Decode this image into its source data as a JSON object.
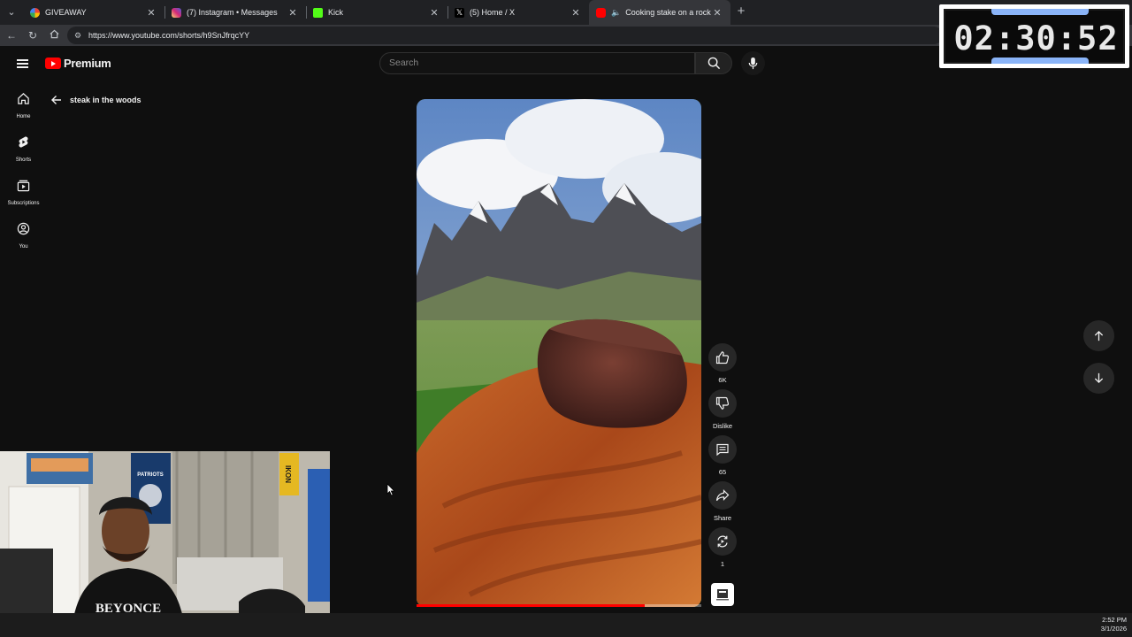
{
  "browser": {
    "tabs": [
      {
        "title": "GIVEAWAY",
        "favicon_color": "#4285f4"
      },
      {
        "title": "(7) Instagram • Messages",
        "favicon_color": "#d6249f"
      },
      {
        "title": "Kick",
        "favicon_color": "#53fc18"
      },
      {
        "title": "(5) Home / X",
        "favicon_color": "#ffffff"
      },
      {
        "title": "Cooking stake on a rock in m",
        "favicon_color": "#ff0000",
        "active": true
      }
    ],
    "url": "https://www.youtube.com/shorts/h9SnJfrqcYY"
  },
  "youtube": {
    "logo_text": "Premium",
    "search_placeholder": "Search",
    "accent": "#ff0000",
    "guide": [
      {
        "label": "Home",
        "icon": "home-icon"
      },
      {
        "label": "Shorts",
        "icon": "shorts-icon"
      },
      {
        "label": "Subscriptions",
        "icon": "subscriptions-icon"
      },
      {
        "label": "You",
        "icon": "you-icon"
      }
    ],
    "back_title": "steak in the woods"
  },
  "short": {
    "like_count": "6K",
    "dislike_label": "Dislike",
    "comment_count": "65",
    "share_label": "Share",
    "remix_count": "1",
    "progress": 0.8
  },
  "overlay": {
    "timer": "02:30:52",
    "webcam_shirt_text": "BEYONCE",
    "poster_text": "PATRIOTS",
    "banner_text": "IKON"
  },
  "taskbar": {
    "time": "2:52 PM",
    "date": "3/1/2026"
  }
}
